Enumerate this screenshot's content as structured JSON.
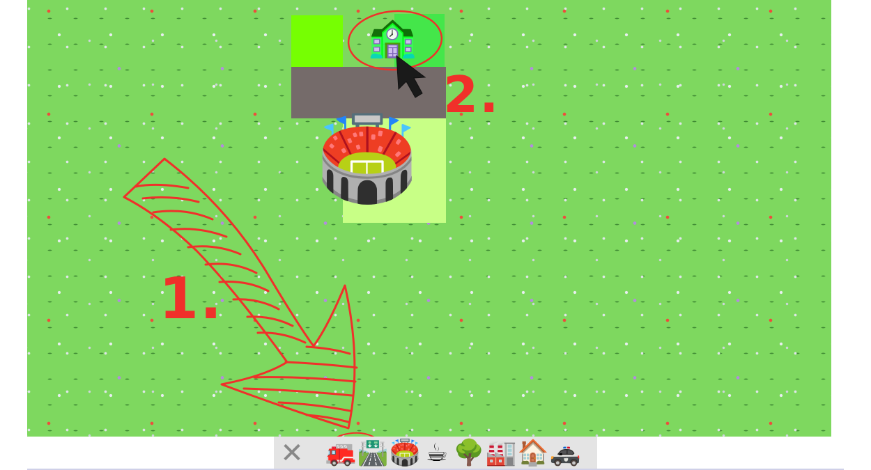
{
  "annotations": {
    "step1_label": "1.",
    "step2_label": "2."
  },
  "map": {
    "tiles": [
      {
        "kind": "grass",
        "color": "#76ff02"
      },
      {
        "kind": "road",
        "color": "#756b6a"
      },
      {
        "kind": "school",
        "icon": "school-building-icon",
        "glyph": "🏫",
        "color": "#44e64a"
      },
      {
        "kind": "stadium",
        "icon": "stadium-icon",
        "glyph": "🏟️",
        "color": "#c8ff86"
      }
    ]
  },
  "toolbar": {
    "items": [
      {
        "name": "close-icon",
        "glyph": "✕"
      },
      {
        "name": "fire-engine-icon",
        "glyph": "🚒"
      },
      {
        "name": "motorway-icon",
        "glyph": "🛣️"
      },
      {
        "name": "stadium-icon",
        "glyph": "🏟️"
      },
      {
        "name": "coffee-icon",
        "glyph": "☕"
      },
      {
        "name": "tree-icon",
        "glyph": "🌳"
      },
      {
        "name": "factory-icon",
        "glyph": "🏭"
      },
      {
        "name": "house-icon",
        "glyph": "🏠"
      },
      {
        "name": "police-car-icon",
        "glyph": "🚓"
      }
    ]
  },
  "colors": {
    "annotation": "#f0302a",
    "map_background": "#7ed85f",
    "toolbar_background": "#e4e4e4"
  }
}
